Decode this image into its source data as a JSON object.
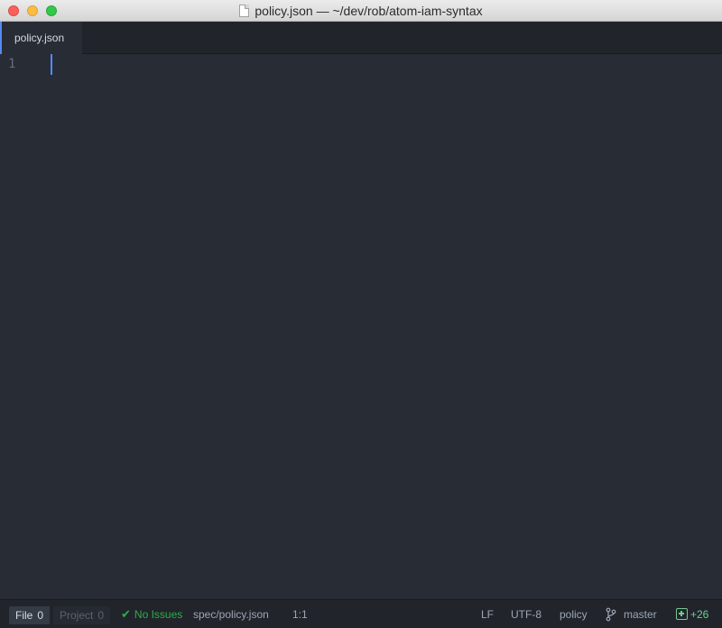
{
  "window": {
    "title": "policy.json — ~/dev/rob/atom-iam-syntax"
  },
  "tabs": [
    {
      "label": "policy.json",
      "active": true
    }
  ],
  "editor": {
    "line_numbers": [
      "1"
    ]
  },
  "statusbar": {
    "file_label": "File",
    "file_count": "0",
    "project_label": "Project",
    "project_count": "0",
    "linter_status": "No Issues",
    "file_path": "spec/policy.json",
    "cursor_position": "1:1",
    "line_ending": "LF",
    "encoding": "UTF-8",
    "grammar": "policy",
    "git_branch": "master",
    "git_added": "+26"
  },
  "colors": {
    "accent": "#568af2",
    "success": "#2fad48",
    "git_added": "#73c990"
  },
  "icons": {
    "document": "document-icon",
    "check": "check-icon",
    "branch": "git-branch-icon",
    "diff_added": "diff-added-icon"
  }
}
